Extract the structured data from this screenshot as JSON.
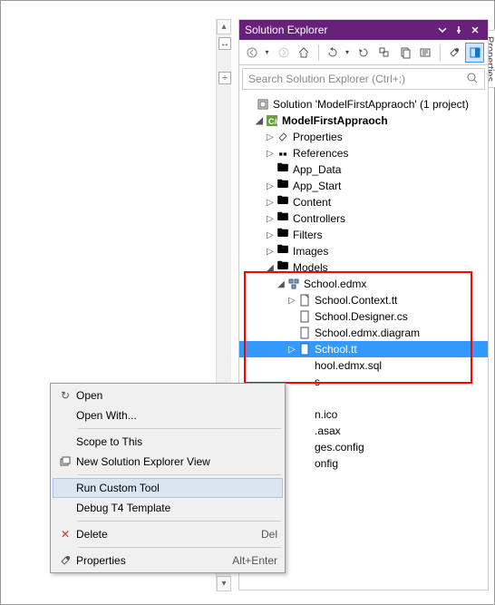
{
  "side_tab": "Properties",
  "panel": {
    "title": "Solution Explorer",
    "search_placeholder": "Search Solution Explorer (Ctrl+;)"
  },
  "tree": {
    "solution": "Solution 'ModelFirstAppraoch' (1 project)",
    "project": "ModelFirstAppraoch",
    "properties": "Properties",
    "references": "References",
    "app_data": "App_Data",
    "app_start": "App_Start",
    "content": "Content",
    "controllers": "Controllers",
    "filters": "Filters",
    "images": "Images",
    "models": "Models",
    "school_edmx": "School.edmx",
    "school_context_tt": "School.Context.tt",
    "school_designer_cs": "School.Designer.cs",
    "school_edmx_diagram": "School.edmx.diagram",
    "school_tt": "School.tt",
    "school_edmx_sql": "hool.edmx.sql",
    "truncated_s": "s",
    "truncated_nico": "n.ico",
    "truncated_asax": ".asax",
    "truncated_gesconfig": "ges.config",
    "truncated_onfig": "onfig"
  },
  "menu": {
    "open": "Open",
    "open_with": "Open With...",
    "scope_to_this": "Scope to This",
    "new_solution_explorer_view": "New Solution Explorer View",
    "run_custom_tool": "Run Custom Tool",
    "debug_t4": "Debug T4 Template",
    "delete": "Delete",
    "delete_shortcut": "Del",
    "properties": "Properties",
    "properties_shortcut": "Alt+Enter"
  }
}
